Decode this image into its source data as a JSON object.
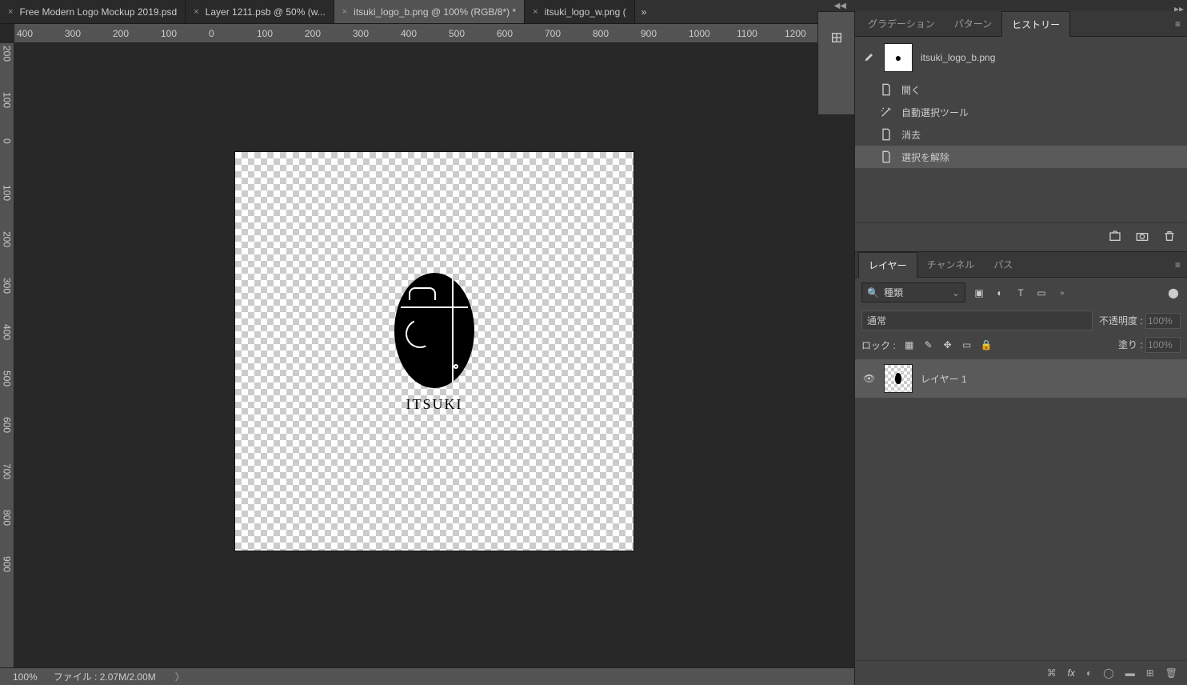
{
  "tabs": [
    {
      "label": "Free Modern Logo Mockup 2019.psd"
    },
    {
      "label": "Layer 1211.psb @ 50% (w..."
    },
    {
      "label": "itsuki_logo_b.png @ 100% (RGB/8*) *",
      "active": true
    },
    {
      "label": "itsuki_logo_w.png ("
    }
  ],
  "ruler_h": [
    "400",
    "300",
    "200",
    "100",
    "0",
    "100",
    "200",
    "300",
    "400",
    "500",
    "600",
    "700",
    "800",
    "900",
    "1000",
    "1100",
    "1200"
  ],
  "ruler_v": [
    "200",
    "100",
    "0",
    "100",
    "200",
    "300",
    "400",
    "500",
    "600",
    "700",
    "800",
    "900"
  ],
  "panel_tabs_top": {
    "gradation": "グラデーション",
    "pattern": "パターン",
    "history": "ヒストリー"
  },
  "history": {
    "doc_name": "itsuki_logo_b.png",
    "items": [
      {
        "icon": "doc",
        "label": "開く"
      },
      {
        "icon": "wand",
        "label": "自動選択ツール"
      },
      {
        "icon": "doc",
        "label": "消去"
      },
      {
        "icon": "doc",
        "label": "選択を解除",
        "selected": true
      }
    ]
  },
  "panel_tabs_bottom": {
    "layers": "レイヤー",
    "channels": "チャンネル",
    "paths": "パス"
  },
  "layers": {
    "filter_label": "種類",
    "blend_mode": "通常",
    "opacity_label": "不透明度 :",
    "opacity_value": "100%",
    "lock_label": "ロック :",
    "fill_label": "塗り :",
    "fill_value": "100%",
    "items": [
      {
        "name": "レイヤー 1"
      }
    ]
  },
  "logo_text": "ITSUKI",
  "status": {
    "zoom": "100%",
    "file_label": "ファイル :",
    "file_value": "2.07M/2.00M"
  }
}
